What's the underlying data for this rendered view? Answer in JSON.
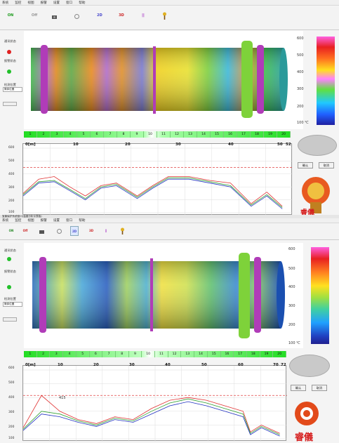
{
  "menu": [
    "系统",
    "监控",
    "视图",
    "报警",
    "设置",
    "窗口",
    "帮助"
  ],
  "toolbar_top": {
    "on": "ON",
    "off": "Off",
    "d2": "2D",
    "d3": "3D",
    "pause": "||"
  },
  "toolbar_bottom": {
    "on": "ON",
    "off": "Off",
    "d2": "2D",
    "d3": "3D",
    "pause": "||",
    "d2_sub": "▾"
  },
  "title_bottom": "宝鼎保护系统窑口(温度分析仪表板)",
  "left": {
    "comm": "通讯状态",
    "alarm": "报警状态",
    "pos": "检测位置",
    "select": "筒体位置",
    "btn": ""
  },
  "colors": {
    "red": "#e02020",
    "green": "#22c02a",
    "accent": "#d62020"
  },
  "colorbar_top": {
    "ticks": [
      "600",
      "500",
      "400",
      "300",
      "200",
      "100 ℃"
    ]
  },
  "colorbar_bottom": {
    "ticks": [
      "600",
      "500",
      "400",
      "300",
      "200",
      "100 ℃"
    ]
  },
  "segments": [
    "1",
    "2",
    "3",
    "4",
    "5",
    "6",
    "7",
    "8",
    "9",
    "10",
    "11",
    "12",
    "13",
    "14",
    "15",
    "16",
    "17",
    "18",
    "19",
    "20"
  ],
  "top_plot": {
    "unit": "0[m]",
    "xticks": [
      "10",
      "20",
      "30",
      "40",
      "50",
      "52"
    ],
    "yticks": [
      "600",
      "500",
      "400",
      "300",
      "200",
      "100"
    ]
  },
  "bottom_plot": {
    "unit": "0[m]",
    "xticks": [
      "10",
      "20",
      "30",
      "40",
      "50",
      "60",
      "70",
      "72"
    ],
    "yticks": [
      "600",
      "500",
      "400",
      "300",
      "200",
      "100"
    ],
    "marker": "415"
  },
  "buttons": {
    "confirm": "确认",
    "cancel": "取消"
  },
  "logo_text": "睿儀",
  "chart_data": [
    {
      "type": "line",
      "title": "",
      "xlabel": "0[m]",
      "ylabel": "",
      "xlim": [
        0,
        52
      ],
      "ylim": [
        100,
        600
      ],
      "series": [
        {
          "values": [
            [
              0,
              250
            ],
            [
              3,
              360
            ],
            [
              6,
              380
            ],
            [
              9,
              300
            ],
            [
              12,
              230
            ],
            [
              15,
              310
            ],
            [
              18,
              330
            ],
            [
              22,
              230
            ],
            [
              25,
              310
            ],
            [
              28,
              380
            ],
            [
              32,
              380
            ],
            [
              36,
              350
            ],
            [
              40,
              330
            ],
            [
              44,
              170
            ],
            [
              47,
              260
            ],
            [
              50,
              150
            ]
          ]
        },
        {
          "values": [
            [
              0,
              240
            ],
            [
              3,
              340
            ],
            [
              6,
              350
            ],
            [
              9,
              280
            ],
            [
              12,
              210
            ],
            [
              15,
              300
            ],
            [
              18,
              320
            ],
            [
              22,
              220
            ],
            [
              25,
              300
            ],
            [
              28,
              370
            ],
            [
              32,
              370
            ],
            [
              36,
              340
            ],
            [
              40,
              310
            ],
            [
              44,
              160
            ],
            [
              47,
              240
            ],
            [
              50,
              140
            ]
          ]
        },
        {
          "values": [
            [
              0,
              230
            ],
            [
              3,
              330
            ],
            [
              6,
              340
            ],
            [
              9,
              270
            ],
            [
              12,
              200
            ],
            [
              15,
              290
            ],
            [
              18,
              310
            ],
            [
              22,
              210
            ],
            [
              25,
              290
            ],
            [
              28,
              360
            ],
            [
              32,
              360
            ],
            [
              36,
              330
            ],
            [
              40,
              300
            ],
            [
              44,
              150
            ],
            [
              47,
              230
            ],
            [
              50,
              130
            ]
          ]
        }
      ],
      "reference_line": 450
    },
    {
      "type": "line",
      "title": "",
      "xlabel": "0[m]",
      "ylabel": "",
      "xlim": [
        0,
        72
      ],
      "ylim": [
        100,
        600
      ],
      "series": [
        {
          "values": [
            [
              0,
              180
            ],
            [
              5,
              415
            ],
            [
              10,
              300
            ],
            [
              15,
              240
            ],
            [
              20,
              210
            ],
            [
              25,
              260
            ],
            [
              30,
              240
            ],
            [
              35,
              320
            ],
            [
              40,
              380
            ],
            [
              45,
              400
            ],
            [
              50,
              380
            ],
            [
              55,
              340
            ],
            [
              60,
              300
            ],
            [
              62,
              150
            ],
            [
              65,
              200
            ],
            [
              70,
              140
            ]
          ]
        },
        {
          "values": [
            [
              0,
              170
            ],
            [
              5,
              300
            ],
            [
              10,
              280
            ],
            [
              15,
              230
            ],
            [
              20,
              200
            ],
            [
              25,
              250
            ],
            [
              30,
              230
            ],
            [
              35,
              300
            ],
            [
              40,
              360
            ],
            [
              45,
              390
            ],
            [
              50,
              360
            ],
            [
              55,
              320
            ],
            [
              60,
              280
            ],
            [
              62,
              140
            ],
            [
              65,
              190
            ],
            [
              70,
              130
            ]
          ]
        },
        {
          "values": [
            [
              0,
              160
            ],
            [
              5,
              280
            ],
            [
              10,
              260
            ],
            [
              15,
              220
            ],
            [
              20,
              190
            ],
            [
              25,
              240
            ],
            [
              30,
              220
            ],
            [
              35,
              280
            ],
            [
              40,
              340
            ],
            [
              45,
              370
            ],
            [
              50,
              340
            ],
            [
              55,
              300
            ],
            [
              60,
              260
            ],
            [
              62,
              130
            ],
            [
              65,
              180
            ],
            [
              70,
              120
            ]
          ]
        }
      ],
      "reference_line": 415
    }
  ]
}
